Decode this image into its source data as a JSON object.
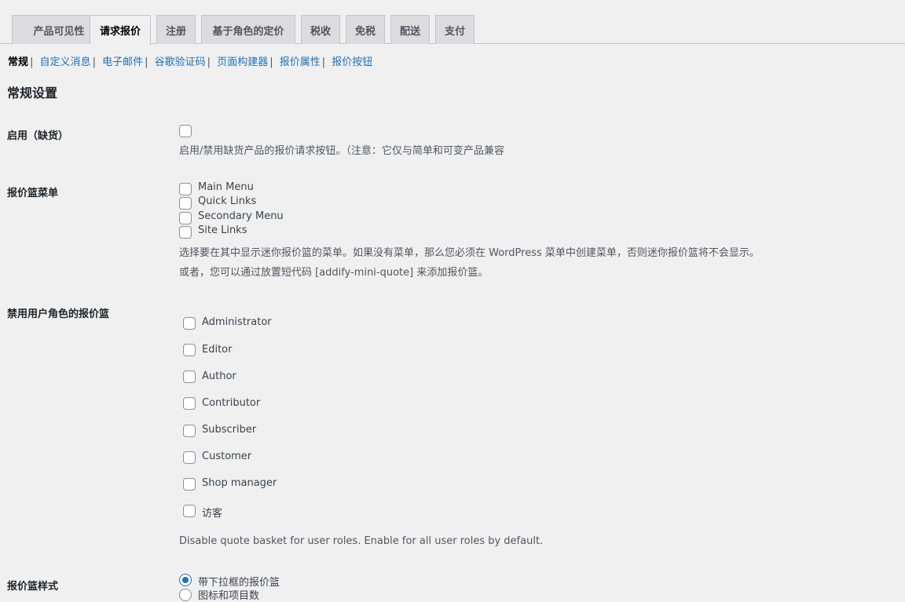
{
  "tabs": [
    "产品可见性",
    "请求报价",
    "注册",
    "基于角色的定价",
    "税收",
    "免税",
    "配送",
    "支付"
  ],
  "active_tab": "请求报价",
  "subnav": {
    "current": "常规",
    "links": [
      "自定义消息",
      "电子邮件",
      "谷歌验证码",
      "页面构建器",
      "报价属性",
      "报价按钮"
    ]
  },
  "section_title": "常规设置",
  "out_of_stock": {
    "label": "启用（缺货）",
    "checked": false,
    "description": "启用/禁用缺货产品的报价请求按钮。（注意：它仅与简单和可变产品兼容"
  },
  "basket_menu": {
    "label": "报价篮菜单",
    "options": [
      "Main Menu",
      "Quick Links",
      "Secondary Menu",
      "Site Links"
    ],
    "description1": "选择要在其中显示迷你报价篮的菜单。如果没有菜单，那么您必须在 WordPress 菜单中创建菜单，否则迷你报价篮将不会显示。",
    "description2": "或者，您可以通过放置短代码 [addify-mini-quote] 来添加报价篮。"
  },
  "disable_roles": {
    "label": "禁用用户角色的报价篮",
    "options": [
      "Administrator",
      "Editor",
      "Author",
      "Contributor",
      "Subscriber",
      "Customer",
      "Shop manager",
      "访客"
    ],
    "description": "Disable quote basket for user roles. Enable for all user roles by default."
  },
  "basket_style": {
    "label": "报价篮样式",
    "options": [
      "带下拉框的报价篮",
      "图标和项目数"
    ],
    "selected": "带下拉框的报价篮"
  },
  "colors": {
    "link": "#2271b1",
    "background": "#f0f0f1",
    "accent": "#2271b1"
  }
}
